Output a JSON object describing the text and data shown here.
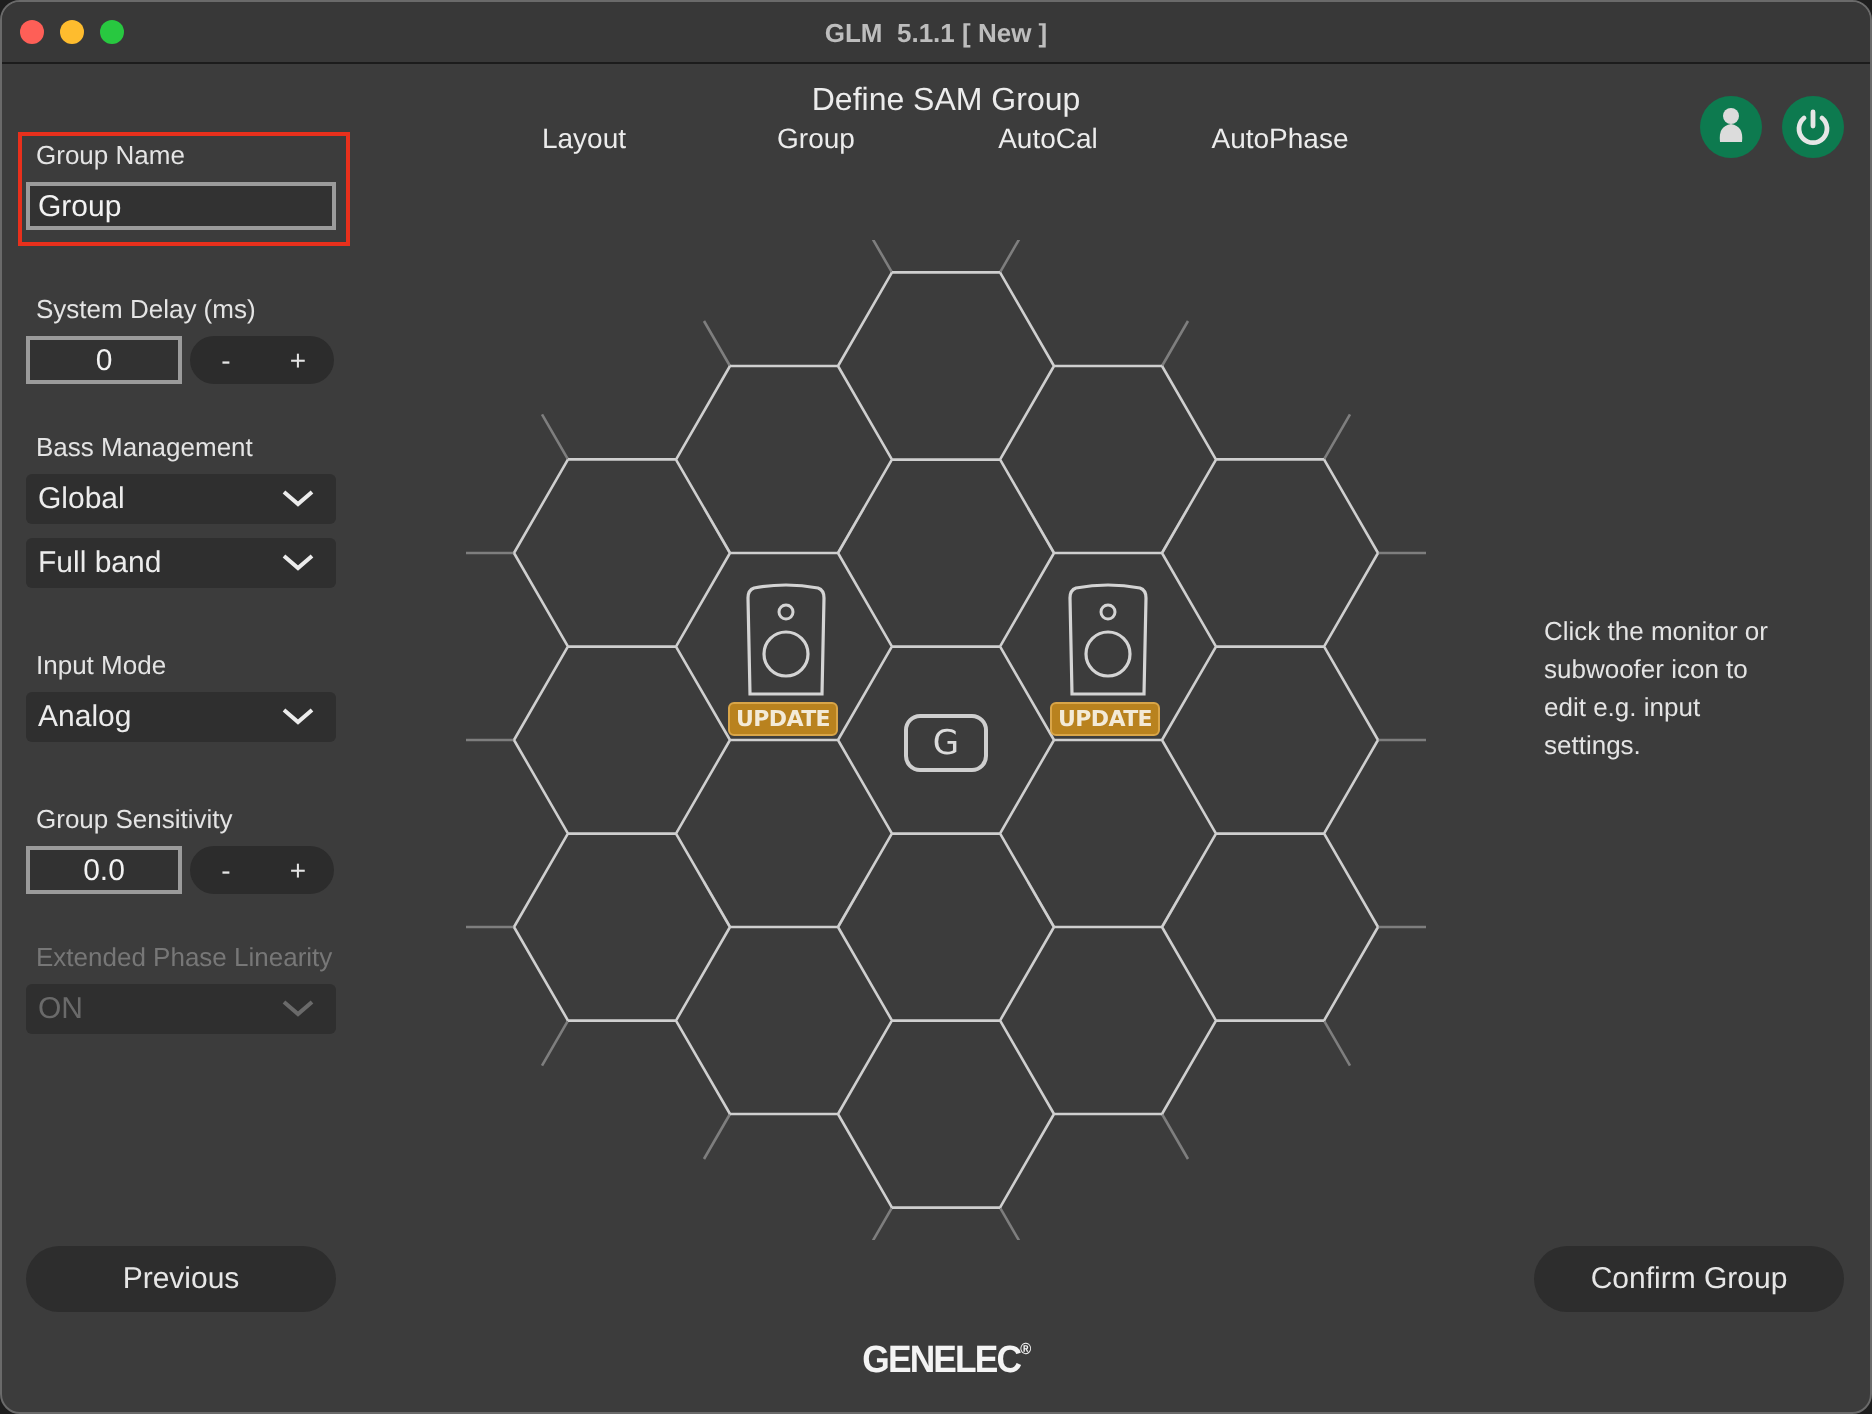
{
  "window": {
    "title": "GLM  5.1.1 [ New ]"
  },
  "header": {
    "title": "Define SAM Group",
    "steps": [
      {
        "label": "Layout"
      },
      {
        "label": "Group"
      },
      {
        "label": "AutoCal"
      },
      {
        "label": "AutoPhase"
      }
    ]
  },
  "sidebar": {
    "sections": [
      {
        "kind": "text",
        "label": "Group Name",
        "value": "Group",
        "highlighted": true
      },
      {
        "kind": "stepper",
        "label": "System Delay (ms)",
        "value": "0",
        "minus": "-",
        "plus": "+"
      },
      {
        "kind": "select",
        "label": "Bass Management",
        "values": [
          "Global",
          "Full band"
        ],
        "disabled": false
      },
      {
        "kind": "select",
        "label": "Input Mode",
        "values": [
          "Analog"
        ],
        "disabled": false
      },
      {
        "kind": "stepper",
        "label": "Group Sensitivity",
        "value": "0.0",
        "minus": "-",
        "plus": "+"
      },
      {
        "kind": "select",
        "label": "Extended Phase Linearity",
        "values": [
          "ON"
        ],
        "disabled": true
      }
    ]
  },
  "canvas": {
    "speakers": [
      {
        "badge": "UPDATE"
      },
      {
        "badge": "UPDATE"
      }
    ],
    "group_icon": "G"
  },
  "hint": "Click the monitor or subwoofer icon to edit e.g. input settings.",
  "buttons": {
    "previous": "Previous",
    "confirm": "Confirm Group"
  },
  "logo": "GENELEC$^{®}$"
}
